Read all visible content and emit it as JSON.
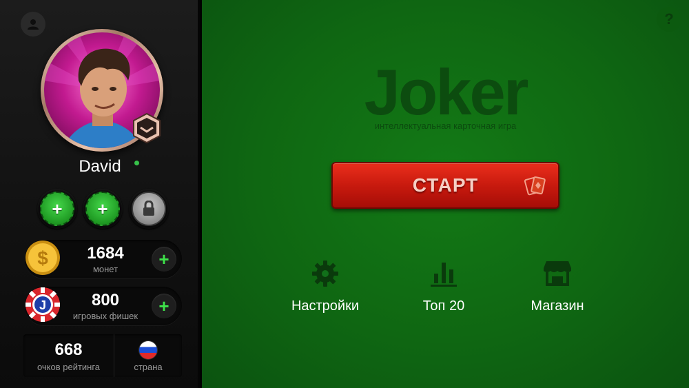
{
  "profile": {
    "name": "David",
    "status": "online"
  },
  "slots": [
    {
      "type": "add",
      "symbol": "+"
    },
    {
      "type": "add",
      "symbol": "+"
    },
    {
      "type": "locked"
    }
  ],
  "coins": {
    "value": "1684",
    "label": "монет",
    "icon": "dollar-coin-icon"
  },
  "chips": {
    "value": "800",
    "label": "игровых фишек",
    "icon": "joker-chip-icon"
  },
  "rating": {
    "value": "668",
    "label": "очков рейтинга"
  },
  "country": {
    "label": "страна",
    "flag": "russia-flag-icon"
  },
  "logo": {
    "title": "Joker",
    "subtitle": "интеллектуальная карточная игра"
  },
  "start_button": {
    "label": "СТАРТ"
  },
  "menu": [
    {
      "label": "Настройки",
      "icon": "gear-icon"
    },
    {
      "label": "Топ 20",
      "icon": "bar-chart-icon"
    },
    {
      "label": "Магазин",
      "icon": "shop-icon"
    }
  ],
  "help": {
    "symbol": "?"
  },
  "colors": {
    "table_green": "#0f6712",
    "start_red": "#c81a0e",
    "plus_green": "#3ee24a"
  }
}
